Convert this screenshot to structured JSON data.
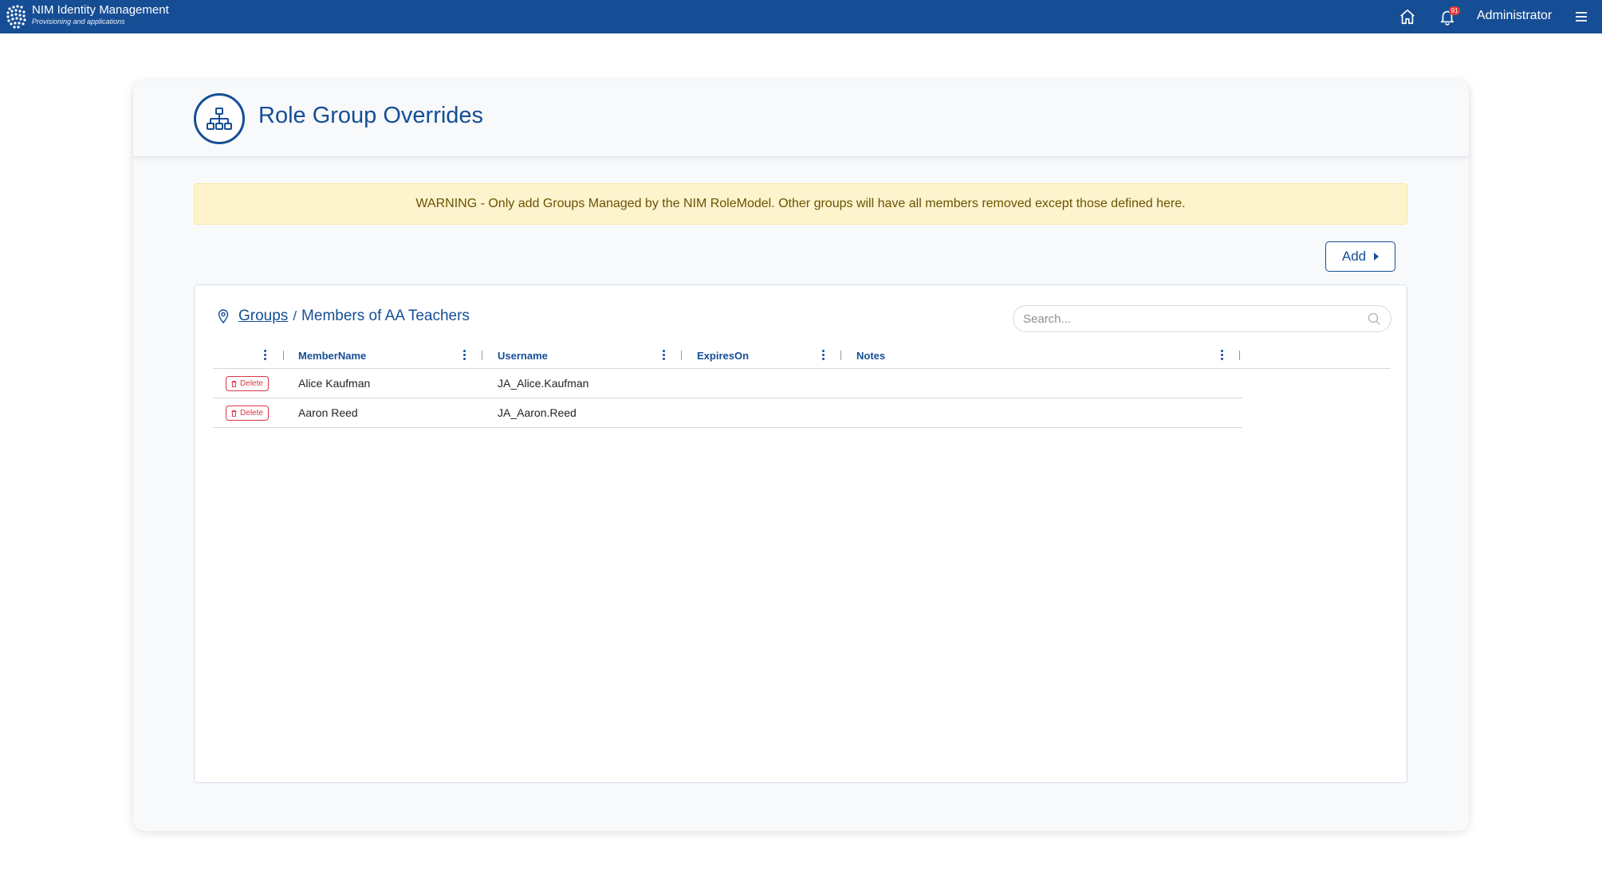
{
  "app": {
    "title": "NIM Identity Management",
    "subtitle": "Provisioning and applications",
    "notification_count": "91",
    "user": "Administrator"
  },
  "page": {
    "title": "Role Group Overrides",
    "warning": "WARNING - Only add Groups Managed by the NIM RoleModel. Other groups will have all members removed except those defined here.",
    "add_label": "Add"
  },
  "breadcrumb": {
    "root": "Groups",
    "separator": "/",
    "current": "Members of AA Teachers"
  },
  "search": {
    "placeholder": "Search..."
  },
  "table": {
    "columns": [
      "MemberName",
      "Username",
      "ExpiresOn",
      "Notes"
    ],
    "delete_label": "Delete",
    "rows": [
      {
        "member_name": "Alice Kaufman",
        "username": "JA_Alice.Kaufman",
        "expires_on": "",
        "notes": ""
      },
      {
        "member_name": "Aaron Reed",
        "username": "JA_Aaron.Reed",
        "expires_on": "",
        "notes": ""
      }
    ]
  },
  "colors": {
    "primary": "#164e95",
    "warning_bg": "#fdf3cd",
    "danger": "#dc3545"
  },
  "icons": [
    "logo-icon",
    "home-icon",
    "bell-icon",
    "menu-icon",
    "org-chart-icon",
    "location-pin-icon",
    "search-icon",
    "trash-icon",
    "column-menu-icon",
    "caret-right-icon"
  ]
}
